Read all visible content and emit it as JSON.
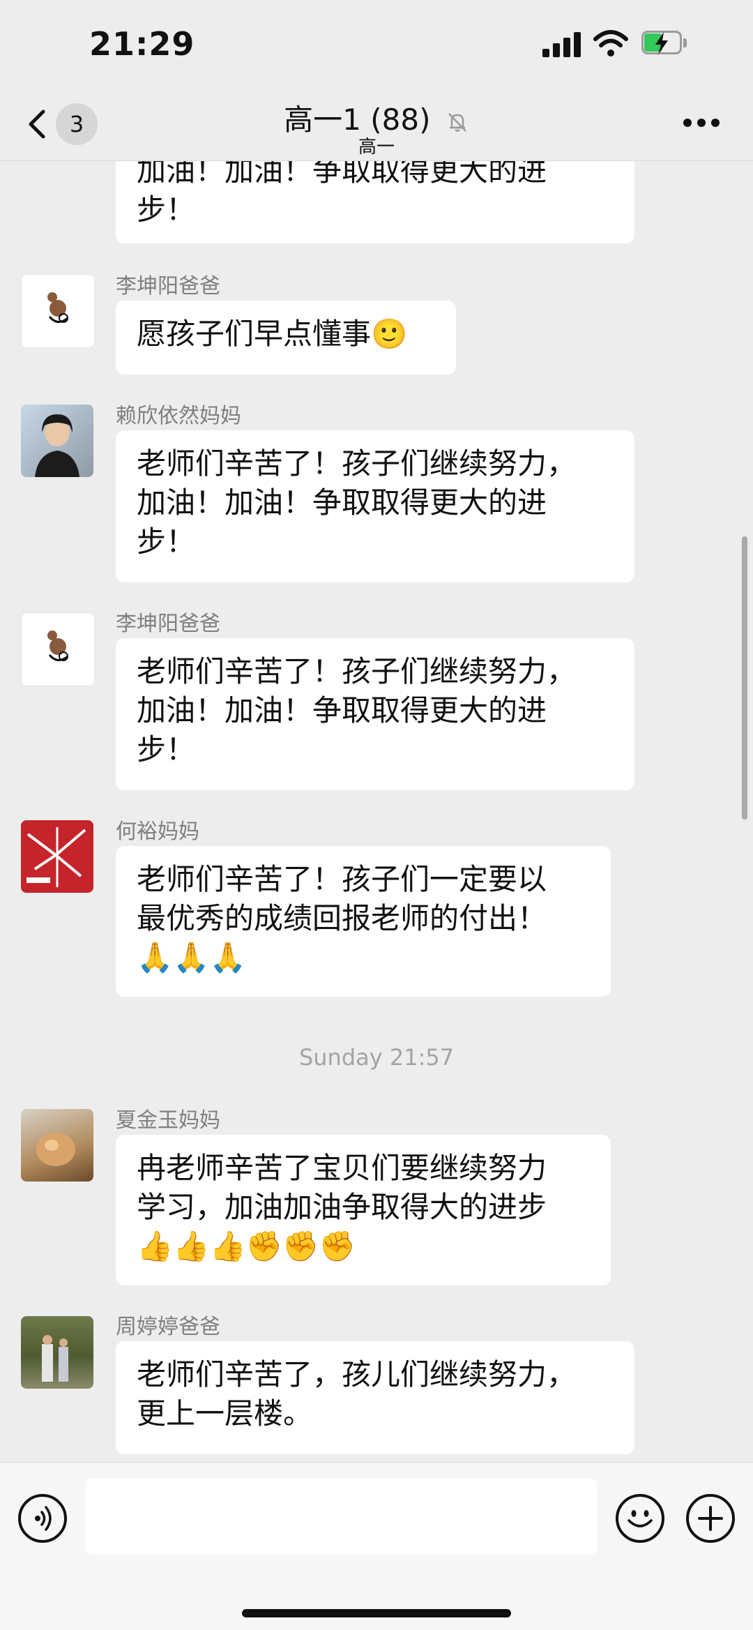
{
  "status_bar": {
    "time": "21:29"
  },
  "nav": {
    "back_count": "3",
    "title": "高一1 (88)",
    "subtitle": "高一"
  },
  "messages": [
    {
      "lines": [
        "加油！加油！争取取得更大的进",
        "步！"
      ]
    },
    {
      "sender": "李坤阳爸爸",
      "lines": [
        "愿孩子们早点懂事🙂"
      ]
    },
    {
      "sender": "赖欣依然妈妈",
      "lines": [
        "老师们辛苦了！孩子们继续努力，",
        "加油！加油！争取取得更大的进",
        "步！"
      ]
    },
    {
      "sender": "李坤阳爸爸",
      "lines": [
        "老师们辛苦了！孩子们继续努力，",
        "加油！加油！争取取得更大的进",
        "步！"
      ]
    },
    {
      "sender": "何裕妈妈",
      "lines": [
        "老师们辛苦了！孩子们一定要以",
        "最优秀的成绩回报老师的付出！",
        "🙏🙏🙏"
      ]
    },
    {
      "sender": "夏金玉妈妈",
      "lines": [
        "冉老师辛苦了宝贝们要继续努力",
        "学习，加油加油争取得大的进步",
        "👍👍👍✊✊✊"
      ]
    },
    {
      "sender": "周婷婷爸爸",
      "lines": [
        "老师们辛苦了，孩儿们继续努力，",
        "更上一层楼。"
      ]
    }
  ],
  "timestamp": "Sunday 21:57",
  "icons": {
    "back": "chevron-left-icon",
    "mute": "bell-slash-icon",
    "more": "more-dots-icon",
    "voice": "voice-icon",
    "emoji": "emoji-icon",
    "plus": "plus-icon"
  },
  "colors": {
    "battery": "#34c759",
    "background": "#ededed",
    "bubble": "#ffffff"
  }
}
